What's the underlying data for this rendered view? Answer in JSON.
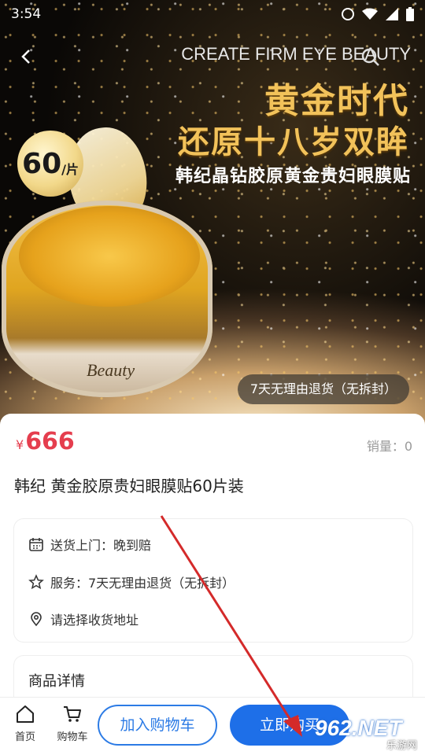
{
  "status_bar": {
    "time": "3:54"
  },
  "hero": {
    "en_headline": "CREATE FIRM EYE BEAUTY",
    "headline_1": "黄金时代",
    "headline_2": "还原十八岁双眸",
    "subheadline": "韩纪晶钻胶原黄金贵妇眼膜贴",
    "badge_count": "60",
    "badge_unit": "/片",
    "jar_brand": "Beauty",
    "return_pill": "7天无理由退货（无拆封）"
  },
  "product": {
    "currency": "¥",
    "price": "666",
    "sales_label": "销量：0",
    "title": "韩纪 黄金胶原贵妇眼膜贴60片装"
  },
  "services": [
    {
      "icon": "calendar-icon",
      "text": "送货上门：晚到赔"
    },
    {
      "icon": "star-outline-icon",
      "text": "服务：7天无理由退货（无拆封）"
    },
    {
      "icon": "location-pin-icon",
      "text": "请选择收货地址"
    }
  ],
  "detail": {
    "title": "商品详情"
  },
  "bottom_bar": {
    "home_label": "首页",
    "cart_label": "购物车",
    "add_cart_button": "加入购物车",
    "buy_now_button": "立即购买"
  },
  "watermark": {
    "logo": "962.NET",
    "sub": "乐游网"
  },
  "colors": {
    "price": "#e53e4e",
    "accent": "#1e6fe8",
    "gold": "#f2c25a",
    "annotation_arrow": "#d42a2a"
  }
}
